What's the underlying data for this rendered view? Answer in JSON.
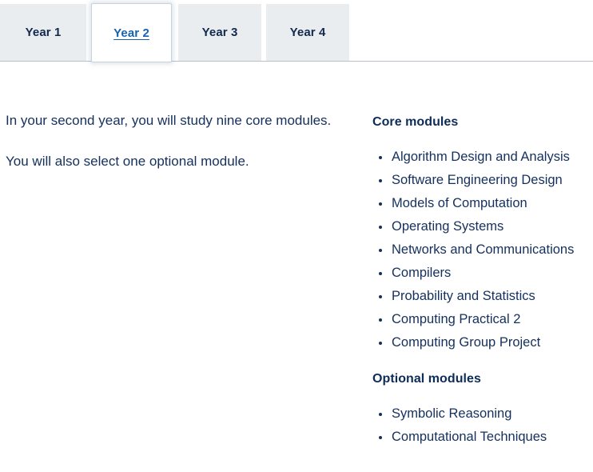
{
  "tabs": [
    {
      "label": "Year 1",
      "active": false
    },
    {
      "label": "Year 2",
      "active": true
    },
    {
      "label": "Year 3",
      "active": false
    },
    {
      "label": "Year 4",
      "active": false
    }
  ],
  "intro": {
    "paragraph_1": "In your second year, you will study nine core modules.",
    "paragraph_2": "You will also select one optional module."
  },
  "core": {
    "heading": "Core modules",
    "items": [
      "Algorithm Design and Analysis",
      "Software Engineering Design",
      "Models of Computation",
      "Operating Systems",
      "Networks and Communications",
      "Compilers",
      "Probability and Statistics",
      "Computing Practical 2",
      "Computing Group Project"
    ]
  },
  "optional": {
    "heading": "Optional modules",
    "items": [
      "Symbolic Reasoning",
      "Computational Techniques"
    ]
  },
  "colors": {
    "text": "#14305c",
    "heading": "#0d2c58",
    "active_tab_link": "#1862ad",
    "inactive_tab_bg": "#e9edef",
    "rule": "#b9c0c7"
  }
}
